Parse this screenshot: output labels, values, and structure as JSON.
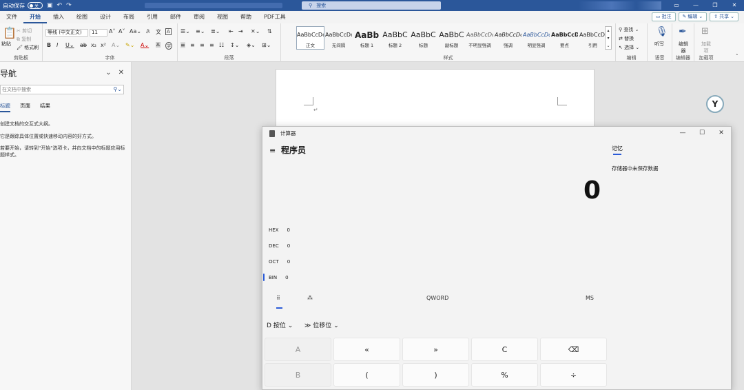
{
  "titlebar": {
    "autosave": "自动保存",
    "toggle": "关",
    "search": "搜索",
    "qa_icons": [
      "save-icon",
      "undo-icon",
      "redo-icon"
    ]
  },
  "menu": {
    "tabs": [
      "文件",
      "开始",
      "插入",
      "绘图",
      "设计",
      "布局",
      "引用",
      "邮件",
      "审阅",
      "视图",
      "帮助",
      "PDF工具"
    ],
    "active": "开始",
    "comment": "批注",
    "edit": "编辑",
    "share": "共享"
  },
  "ribbon": {
    "clipboard": {
      "paste": "粘贴",
      "cut": "剪切",
      "copy": "复制",
      "painter": "格式刷",
      "label": "剪贴板"
    },
    "font": {
      "family": "等线 (中文正文)",
      "size": "11",
      "label": "字体"
    },
    "paragraph": {
      "label": "段落"
    },
    "styles": {
      "label": "样式",
      "items": [
        {
          "preview": "AaBbCcDc",
          "name": "正文"
        },
        {
          "preview": "AaBbCcDc",
          "name": "无间隔"
        },
        {
          "preview": "AaBb",
          "name": "标题 1"
        },
        {
          "preview": "AaBbC",
          "name": "标题 2"
        },
        {
          "preview": "AaBbC",
          "name": "标题"
        },
        {
          "preview": "AaBbC",
          "name": "副标题"
        },
        {
          "preview": "AaBbCcDc",
          "name": "不明显强调"
        },
        {
          "preview": "AaBbCcDc",
          "name": "强调"
        },
        {
          "preview": "AaBbCcDc",
          "name": "明显强调"
        },
        {
          "preview": "AaBbCcDc",
          "name": "要点"
        },
        {
          "preview": "AaBbCcDc",
          "name": "引用"
        }
      ]
    },
    "editing": {
      "find": "查找",
      "replace": "替换",
      "select": "选择",
      "label": "编辑"
    },
    "voice": {
      "dictate": "听写",
      "label": "语音"
    },
    "editor": {
      "name": "编辑器",
      "label": "编辑器"
    },
    "addins": {
      "name": "加载项",
      "label": "加载项"
    }
  },
  "navpane": {
    "title": "导航",
    "search_placeholder": "在文档中搜索",
    "tabs": [
      "标题",
      "页面",
      "结果"
    ],
    "hints": [
      "创建文档的交互式大纲。",
      "它是跟踪具体位置或快速移动内容的好方式。",
      "若要开始，请转到\"开始\"选项卡，并向文档中的标题应用标题样式。"
    ]
  },
  "calculator": {
    "title": "计算器",
    "mode": "程序员",
    "display": "0",
    "radix": [
      {
        "name": "HEX",
        "value": "0"
      },
      {
        "name": "DEC",
        "value": "0"
      },
      {
        "name": "OCT",
        "value": "0"
      },
      {
        "name": "BIN",
        "value": "0"
      }
    ],
    "word_size": "QWORD",
    "ms": "MS",
    "bitwise": "按位",
    "bitshift": "位移位",
    "memory_tab": "记忆",
    "memory_empty": "存储器中未保存数据",
    "keys": [
      [
        "A",
        "«",
        "»",
        "C",
        "⌫"
      ],
      [
        "B",
        "(",
        ")",
        "%",
        "÷"
      ]
    ]
  }
}
